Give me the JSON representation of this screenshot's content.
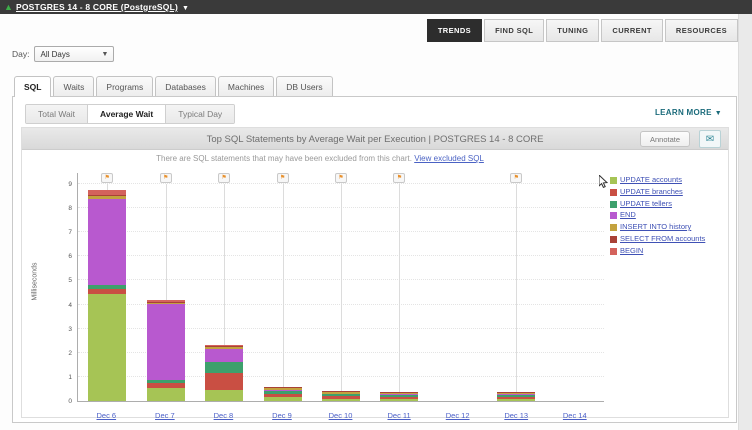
{
  "header": {
    "brand": "POSTGRES 14 - 8 CORE (PostgreSQL)",
    "nav": [
      {
        "label": "TRENDS",
        "active": true
      },
      {
        "label": "FIND SQL",
        "active": false
      },
      {
        "label": "TUNING",
        "active": false
      },
      {
        "label": "CURRENT",
        "active": false
      },
      {
        "label": "RESOURCES",
        "active": false
      }
    ]
  },
  "day": {
    "label": "Day:",
    "value": "All Days"
  },
  "tabs": {
    "items": [
      "SQL",
      "Waits",
      "Programs",
      "Databases",
      "Machines",
      "DB Users"
    ]
  },
  "view_toggle": {
    "items": [
      "Total Wait",
      "Average Wait",
      "Typical Day"
    ]
  },
  "learn_more": {
    "label": "LEARN MORE"
  },
  "chart_header": {
    "title": "Top SQL Statements by Average Wait per Execution | POSTGRES 14 - 8 CORE",
    "annotate": "Annotate"
  },
  "notice": {
    "text": "There are SQL statements that may have been excluded from this chart.",
    "link": "View excluded SQL"
  },
  "icons": {
    "flag": "annotation-flag",
    "flag_color": "#e8912d",
    "mail": "envelope",
    "brand_arrow_color": "#3dae49"
  },
  "chart_data": {
    "type": "bar",
    "stacked": true,
    "title": "Top SQL Statements by Average Wait per Execution | POSTGRES 14 - 8 CORE",
    "ylabel": "Milliseconds",
    "ylim": [
      0,
      9
    ],
    "yticks": [
      0,
      1,
      2,
      3,
      4,
      5,
      6,
      7,
      8,
      9
    ],
    "grid": true,
    "legend_position": "right",
    "categories": [
      "Dec 6",
      "Dec 7",
      "Dec 8",
      "Dec 9",
      "Dec 10",
      "Dec 11",
      "Dec 12",
      "Dec 13",
      "Dec 14"
    ],
    "annotation_flags": [
      true,
      true,
      true,
      true,
      true,
      true,
      false,
      true,
      false
    ],
    "series": [
      {
        "name": "UPDATE accounts",
        "color": "#a6c455",
        "values": [
          4.45,
          0.55,
          0.45,
          0.15,
          0.1,
          0.08,
          0,
          0.08,
          0
        ]
      },
      {
        "name": "UPDATE branches",
        "color": "#c94f43",
        "values": [
          0.18,
          0.2,
          0.7,
          0.15,
          0.1,
          0.1,
          0,
          0.1,
          0
        ]
      },
      {
        "name": "UPDATE tellers",
        "color": "#3da06c",
        "values": [
          0.18,
          0.12,
          0.45,
          0.12,
          0.08,
          0.07,
          0,
          0.07,
          0
        ]
      },
      {
        "name": "END",
        "color": "#b859cf",
        "values": [
          3.55,
          3.15,
          0.55,
          0.05,
          0.03,
          0.03,
          0,
          0.03,
          0
        ]
      },
      {
        "name": "INSERT  INTO history",
        "color": "#c3a23e",
        "values": [
          0.15,
          0.05,
          0.1,
          0.08,
          0.07,
          0.06,
          0,
          0.06,
          0
        ]
      },
      {
        "name": "SELECT FROM accounts",
        "color": "#a94136",
        "values": [
          0.05,
          0.03,
          0.03,
          0.03,
          0.02,
          0.02,
          0,
          0.02,
          0
        ]
      },
      {
        "name": "BEGIN",
        "color": "#d4625c",
        "values": [
          0.2,
          0.1,
          0.05,
          0.02,
          0.02,
          0.02,
          0,
          0.02,
          0
        ]
      }
    ]
  }
}
